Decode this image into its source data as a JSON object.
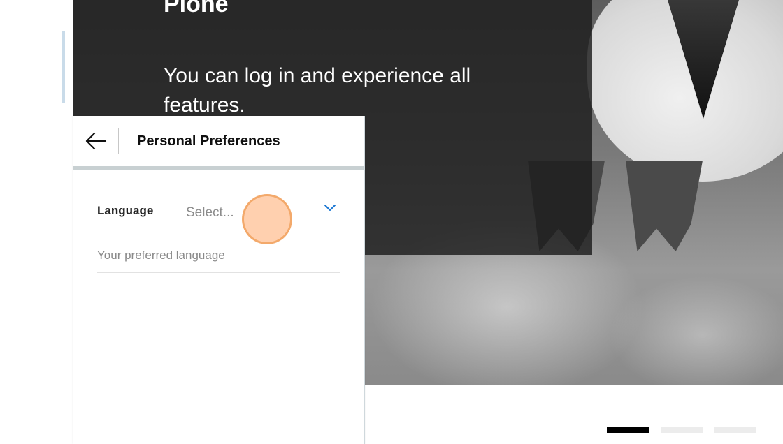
{
  "hero": {
    "title": "Plone",
    "text": "You can log in and experience all features."
  },
  "preferences_panel": {
    "title": "Personal Preferences",
    "back_icon": "arrow-left-icon",
    "fields": [
      {
        "label": "Language",
        "placeholder": "Select...",
        "help": "Your preferred language",
        "icon": "chevron-down-icon"
      }
    ]
  },
  "carousel": {
    "slides": 3,
    "active_index": 0
  },
  "colors": {
    "accent": "#1976d2",
    "panel_border": "#c8d0d2",
    "hero_overlay": "#1c1c1c",
    "cursor": "#ffaa6e"
  }
}
